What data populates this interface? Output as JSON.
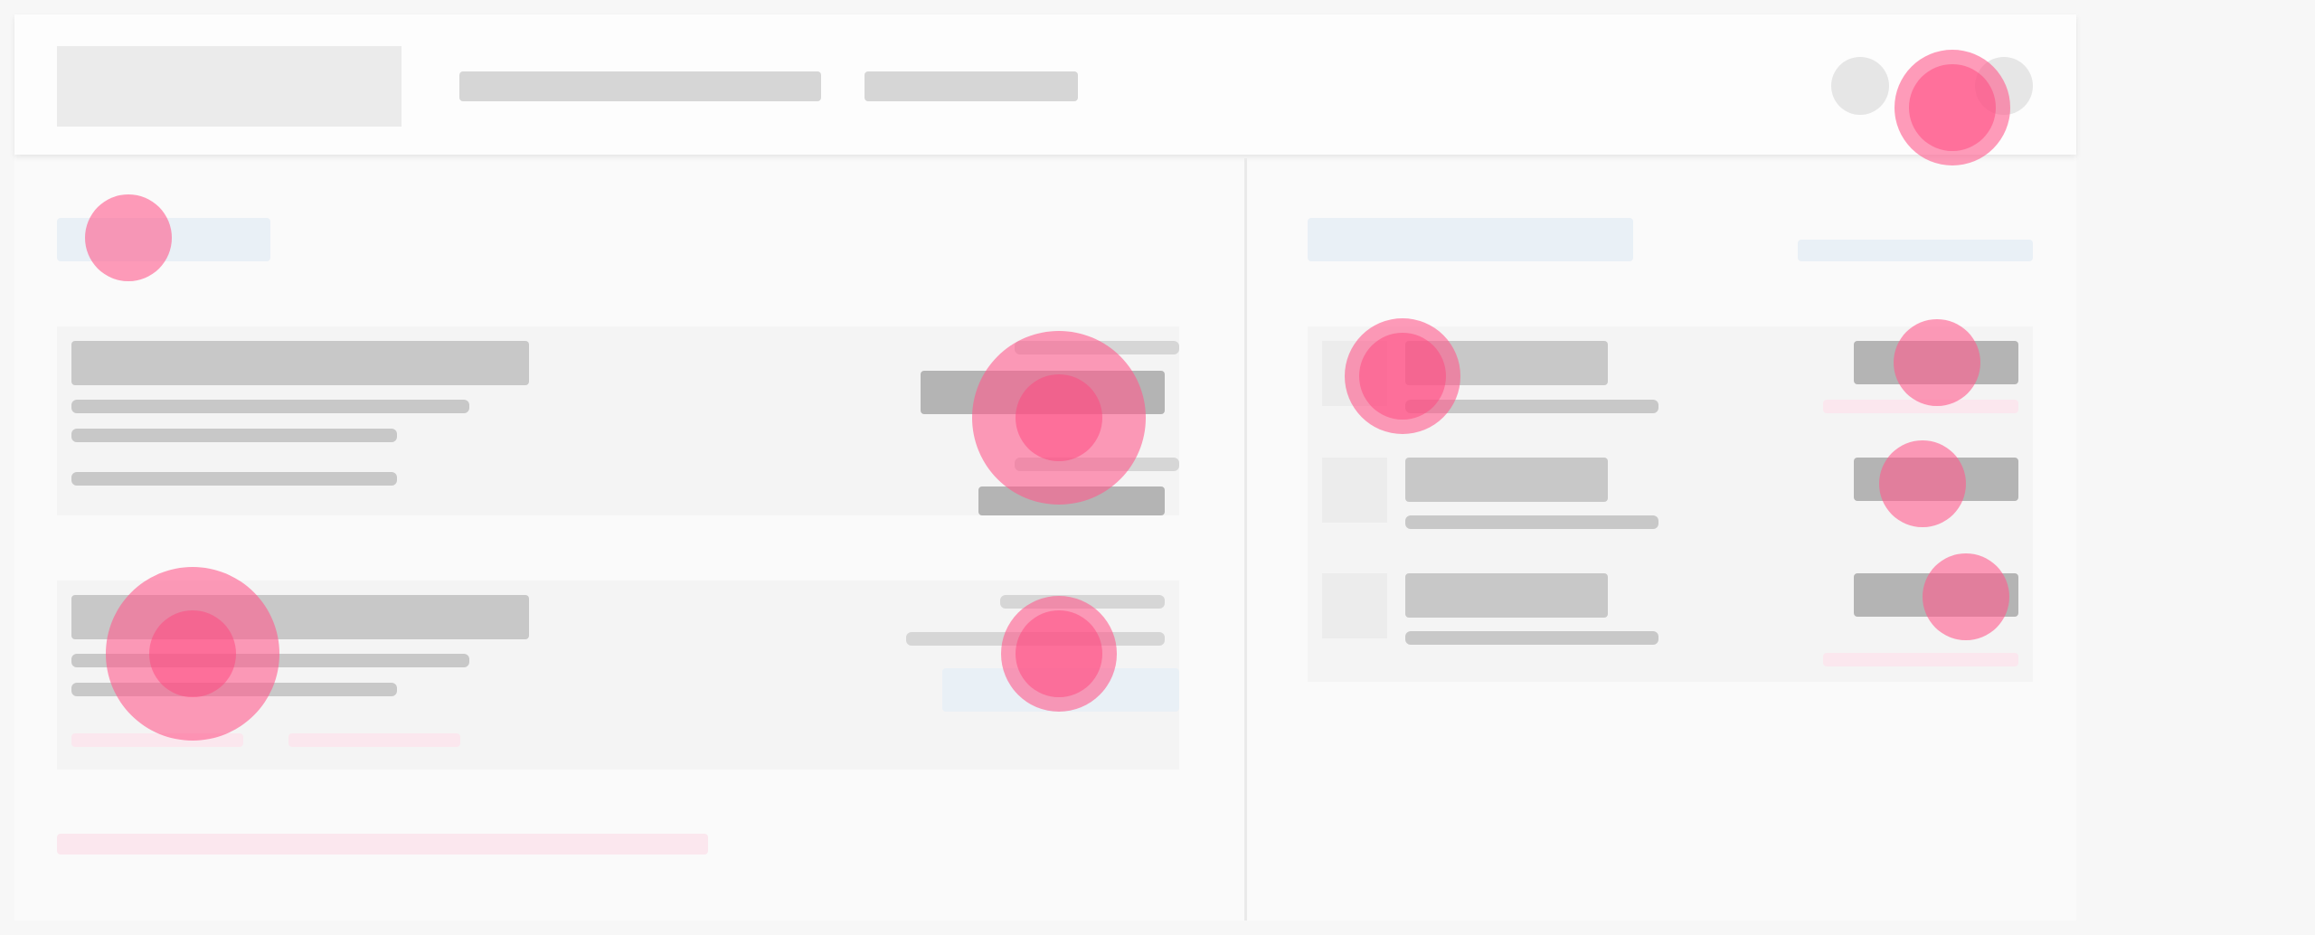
{
  "colors": {
    "page_background": "#f7f7f7",
    "placeholder_bar": "#c8c8c8",
    "placeholder_button": "#b4b4b4",
    "accent_blue_chip": "#e9f0f6",
    "accent_pink_chip": "#fbe7ee",
    "click_overlay": "#ff5a8c"
  },
  "header": {
    "logo_icon": "logo-placeholder",
    "nav_items": [
      "",
      ""
    ],
    "avatar_icons": [
      "avatar-circle-icon",
      "avatar-circle-icon"
    ]
  },
  "left_panel": {
    "heading_chip": "",
    "cards": [
      {
        "title": "",
        "lines": [
          "",
          "",
          ""
        ],
        "meta": [
          "",
          ""
        ],
        "actions": [
          "",
          ""
        ]
      },
      {
        "title": "",
        "lines": [
          "",
          ""
        ],
        "tags": [
          "",
          ""
        ],
        "meta": [
          "",
          ""
        ],
        "action": ""
      }
    ],
    "footer_note": ""
  },
  "right_panel": {
    "heading_chip": "",
    "link_chip": "",
    "list_items": [
      {
        "title": "",
        "subtitle": "",
        "button": "",
        "tag": ""
      },
      {
        "title": "",
        "subtitle": "",
        "button": ""
      },
      {
        "title": "",
        "subtitle": "",
        "button": "",
        "tag": ""
      }
    ]
  },
  "overlays_icon": "tap-indicator-icon"
}
